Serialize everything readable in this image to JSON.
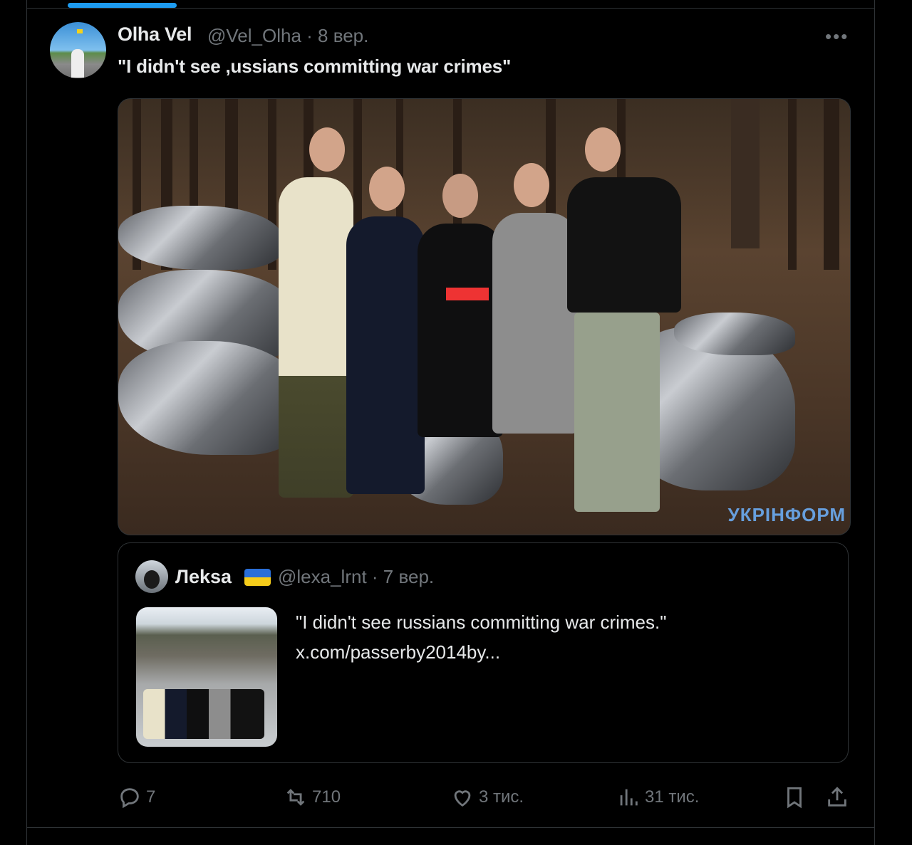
{
  "tweet": {
    "author_name": "Olha Vel",
    "handle_time": "@Vel_Olha · 8 вер.",
    "text": "\"I didn't see ,ussians committing war crimes\"",
    "more_icon": "more-horizontal-icon"
  },
  "media": {
    "watermark": "УКРІНФОРМ"
  },
  "quoted": {
    "author_name": "Леksa",
    "flag_icon": "ukraine-flag-icon",
    "handle_time": "@lexa_lrnt · 7 вер.",
    "text_line1": "\"I didn't see russians committing war crimes.\"",
    "text_line2": "x.com/passerby2014by..."
  },
  "actions": {
    "replies": "7",
    "reposts": "710",
    "likes": "3 тис.",
    "views": "31 тис."
  },
  "colors": {
    "background": "#000000",
    "accent": "#1d9bf0",
    "muted_text": "#71767b",
    "border": "#2f3336"
  }
}
